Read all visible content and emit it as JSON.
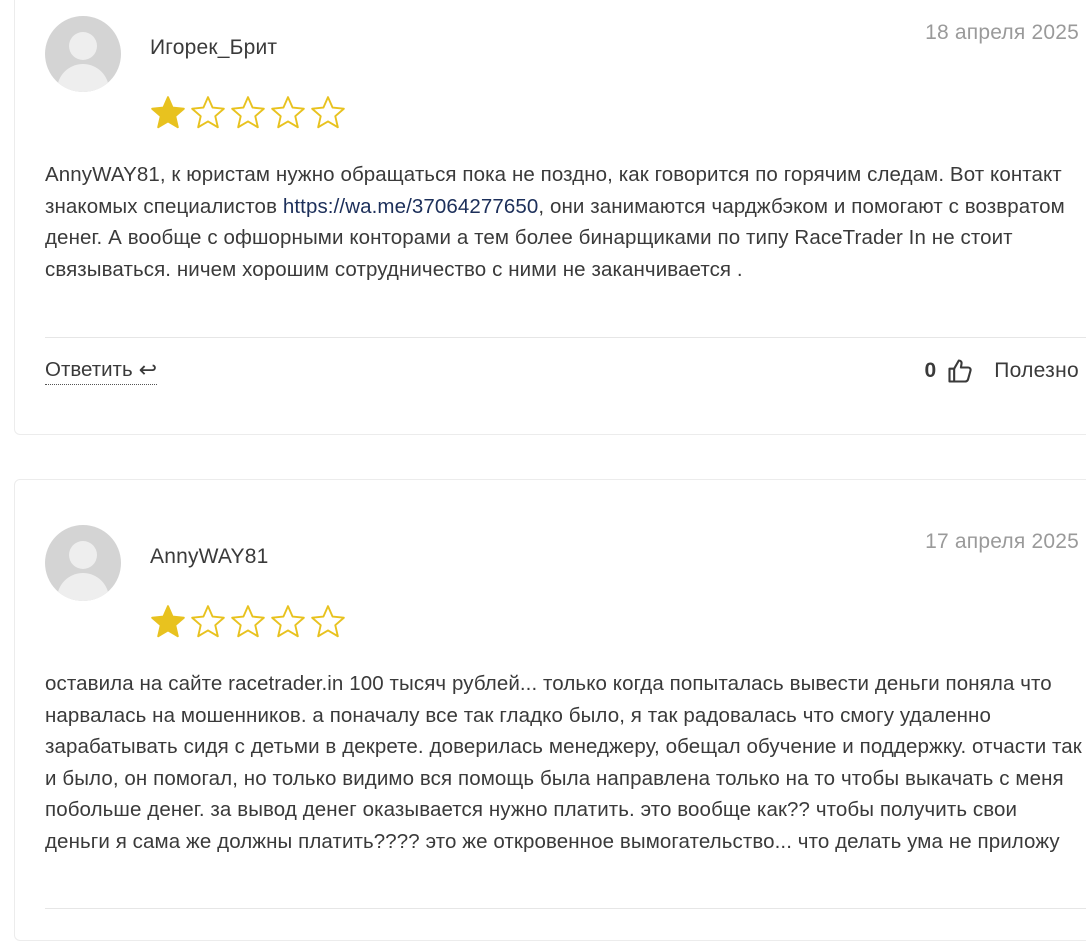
{
  "reviews": [
    {
      "author": "Игорек_Брит",
      "date": "18 апреля 2025",
      "rating": 1,
      "rating_max": 5,
      "text_before_link": "AnnyWAY81, к юристам нужно обращаться пока не поздно, как говорится по горячим следам. Вот контакт знакомых специалистов ",
      "link": "https://wa.me/37064277650",
      "text_after_link": ", они занимаются чарджбэком и помогают с возвратом денег. А вообще с офшорными конторами а тем более бинарщиками по типу RaceTrader In не стоит связываться. ничем хорошим сотрудничество с ними не заканчивается .",
      "reply_label": "Ответить",
      "reply_icon": "↩",
      "helpful_count": "0",
      "helpful_label": "Полезно"
    },
    {
      "author": "AnnyWAY81",
      "date": "17 апреля 2025",
      "rating": 1,
      "rating_max": 5,
      "text": "оставила на сайте racetrader.in 100 тысяч рублей... только когда попыталась вывести деньги поняла что нарвалась на мошенников. а поначалу все так гладко было, я так радовалась что смогу удаленно зарабатывать сидя с детьми в декрете. доверилась менеджеру, обещал обучение и поддержку. отчасти так и было, он помогал, но только видимо вся помощь была направлена только на то чтобы выкачать с меня побольше денег. за вывод денег оказывается нужно платить. это вообще как?? чтобы получить свои деньги я сама же должны платить???? это же откровенное вымогательство... что делать ума не приложу"
    }
  ],
  "colors": {
    "star_fill": "#e8c21f",
    "star_outline": "#e8c21f",
    "date": "#9a9a9a",
    "link": "#1c2f5a"
  }
}
